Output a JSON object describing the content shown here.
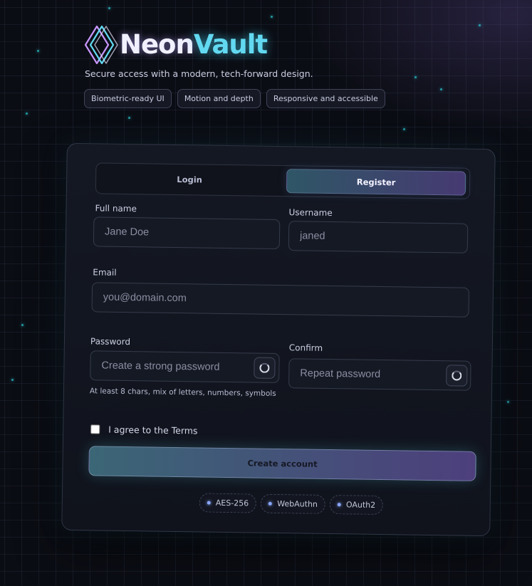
{
  "brand": {
    "name_part1": "Neon",
    "name_part2": "Vault",
    "tagline": "Secure access with a modern, tech-forward design.",
    "features": [
      "Biometric-ready UI",
      "Motion and depth",
      "Responsive and accessible"
    ]
  },
  "tabs": {
    "login": "Login",
    "register": "Register",
    "active": "register"
  },
  "form": {
    "full_name": {
      "label": "Full name",
      "placeholder": "Jane Doe"
    },
    "username": {
      "label": "Username",
      "placeholder": "janed"
    },
    "email": {
      "label": "Email",
      "placeholder": "you@domain.com"
    },
    "password": {
      "label": "Password",
      "placeholder": "Create a strong password",
      "hint": "At least 8 chars, mix of letters, numbers, symbols"
    },
    "confirm": {
      "label": "Confirm",
      "placeholder": "Repeat password"
    },
    "agree_label": "I agree to the Terms",
    "agree_checked": false,
    "submit_label": "Create account"
  },
  "security_badges": [
    "AES-256",
    "WebAuthn",
    "OAuth2"
  ],
  "colors": {
    "background": "#0b0d14",
    "accent_cyan": "#62d9f0",
    "accent_purple": "#463a72",
    "badge_dot": "#8aa6ff"
  },
  "icons": {
    "logo": "neon-diamond-logo-icon",
    "password_toggle": "eye-toggle-icon"
  }
}
